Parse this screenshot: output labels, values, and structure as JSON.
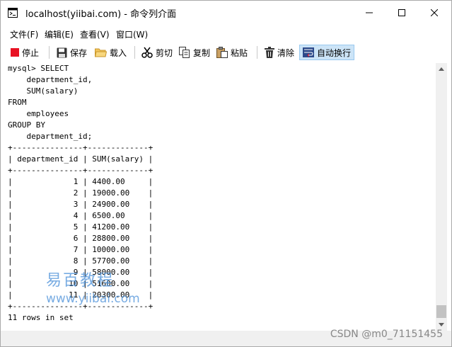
{
  "window": {
    "title": "localhost(yiibai.com) - 命令列介面",
    "controls": {
      "minimize": "—",
      "maximize": "☐",
      "close": "✕"
    }
  },
  "menu": [
    {
      "label": "文件(F)"
    },
    {
      "label": "编辑(E)"
    },
    {
      "label": "查看(V)"
    },
    {
      "label": "窗口(W)"
    }
  ],
  "toolbar": {
    "stop": "停止",
    "save": "保存",
    "load": "载入",
    "cut": "剪切",
    "copy": "复制",
    "paste": "粘贴",
    "clear": "清除",
    "autowrap": "自动换行",
    "icons": [
      "stop-icon",
      "save-icon",
      "folder-icon",
      "scissors-icon",
      "copy-icon",
      "paste-icon",
      "trash-icon",
      "wrap-icon"
    ],
    "colors": {
      "stop": "#e81123",
      "active_bg": "#cce4f7"
    }
  },
  "console": {
    "output": "mysql> SELECT\n    department_id,\n    SUM(salary)\nFROM\n    employees\nGROUP BY\n    department_id;\n+---------------+-------------+\n| department_id | SUM(salary) |\n+---------------+-------------+\n|             1 | 4400.00     |\n|             2 | 19000.00    |\n|             3 | 24900.00    |\n|             4 | 6500.00     |\n|             5 | 41200.00    |\n|             6 | 28800.00    |\n|             7 | 10000.00    |\n|             8 | 57700.00    |\n|             9 | 58000.00    |\n|            10 | 51600.00    |\n|            11 | 20300.00    |\n+---------------+-------------+\n11 rows in set"
  },
  "watermark": {
    "text_cn": "易百教程",
    "url": "www.yiibai.com"
  },
  "footer": {
    "csdn": "CSDN @m0_71151455"
  }
}
